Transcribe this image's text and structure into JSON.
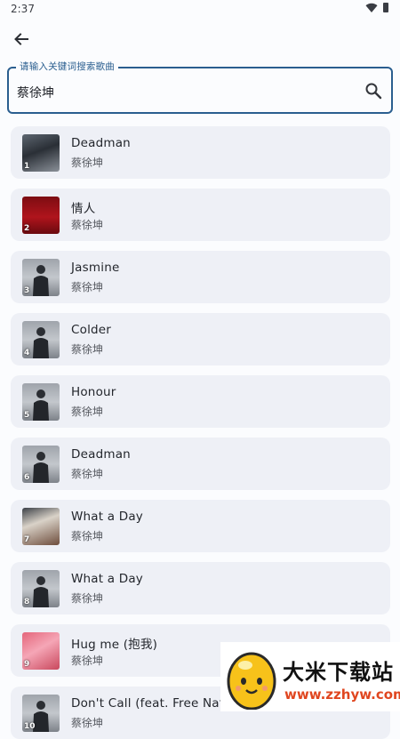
{
  "status": {
    "time": "2:37"
  },
  "search": {
    "label": "请输入关键词搜索歌曲",
    "value": "蔡徐坤"
  },
  "songs": [
    {
      "index": "1",
      "title": "Deadman",
      "artist": "蔡徐坤",
      "cover": "photo-dark"
    },
    {
      "index": "2",
      "title": "情人",
      "artist": "蔡徐坤",
      "cover": "red"
    },
    {
      "index": "3",
      "title": "Jasmine",
      "artist": "蔡徐坤",
      "cover": "portrait"
    },
    {
      "index": "4",
      "title": "Colder",
      "artist": "蔡徐坤",
      "cover": "portrait"
    },
    {
      "index": "5",
      "title": "Honour",
      "artist": "蔡徐坤",
      "cover": "portrait"
    },
    {
      "index": "6",
      "title": "Deadman",
      "artist": "蔡徐坤",
      "cover": "portrait"
    },
    {
      "index": "7",
      "title": "What a Day",
      "artist": "蔡徐坤",
      "cover": "photo-mixed"
    },
    {
      "index": "8",
      "title": "What a Day",
      "artist": "蔡徐坤",
      "cover": "portrait"
    },
    {
      "index": "9",
      "title": "Hug me (抱我)",
      "artist": "蔡徐坤",
      "cover": "pink"
    },
    {
      "index": "10",
      "title": "Don't Call (feat. Free Nation",
      "artist": "蔡徐坤",
      "cover": "portrait"
    }
  ],
  "watermark": {
    "title": "大米下载站",
    "url": "www.zzhyw.com"
  },
  "colors": {
    "accent": "#2a5e8f",
    "card": "#eef0f6",
    "background": "#fbfcfe"
  }
}
